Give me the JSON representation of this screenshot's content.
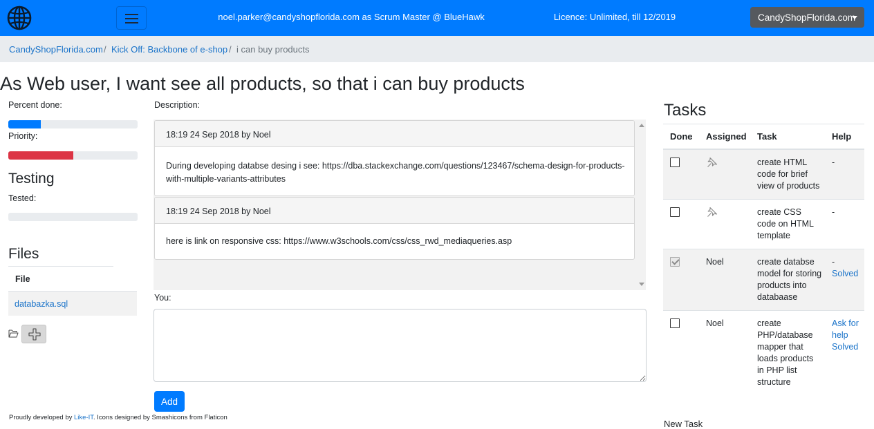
{
  "navbar": {
    "user_info": "noel.parker@candyshopflorida.com as Scrum Master @ BlueHawk",
    "licence": "Licence: Unlimited, till 12/2019",
    "company_dropdown": "CandyShopFlorida.com",
    "brand_color": "#007bff"
  },
  "breadcrumb": {
    "items": [
      "CandyShopFlorida.com",
      "Kick Off: Backbone of e-shop",
      "i can buy products"
    ]
  },
  "page_title": "As Web user, I want see all products, so that i can buy products",
  "progress": {
    "percent_done_label": "Percent done:",
    "percent_done_fraction": 0.25,
    "priority_label": "Priority:",
    "priority_fraction": 0.5,
    "priority_color": "#dc3545"
  },
  "testing": {
    "heading": "Testing",
    "tested_label": "Tested:",
    "tested_fraction": 0
  },
  "files": {
    "heading": "Files",
    "column_header": "File",
    "items": [
      "databazka.sql"
    ]
  },
  "description": {
    "label": "Description:",
    "comments": [
      {
        "header": "18:19 24 Sep 2018 by Noel",
        "body": "During developing databse desing i see: https://dba.stackexchange.com/questions/123467/schema-design-for-products-with-multiple-variants-attributes"
      },
      {
        "header": "18:19 24 Sep 2018 by Noel",
        "body": "here is link on responsive css: https://www.w3schools.com/css/css_rwd_mediaqueries.asp"
      }
    ]
  },
  "new_comment": {
    "label": "You:",
    "value": "",
    "add_button": "Add"
  },
  "footer": {
    "prefix": "Proudly developed by",
    "link": "Like-IT",
    "suffix": ". Icons designed by Smashicons from Flaticon"
  },
  "tasks": {
    "heading": "Tasks",
    "columns": [
      "Done",
      "Assigned",
      "Task",
      "Help"
    ],
    "rows": [
      {
        "done": false,
        "assigned": "",
        "task": "create HTML code for brief view of products",
        "help": "-",
        "help_links": []
      },
      {
        "done": false,
        "assigned": "",
        "task": "create CSS code on HTML template",
        "help": "-",
        "help_links": []
      },
      {
        "done": true,
        "assigned": "Noel",
        "task": "create databse model for storing products into databaase",
        "help": "-",
        "help_links": [
          "Solved"
        ]
      },
      {
        "done": false,
        "assigned": "Noel",
        "task": "create PHP/database mapper that loads products in PHP list structure",
        "help": "",
        "help_links": [
          "Ask for help",
          "Solved"
        ]
      }
    ],
    "more_label": "New Task"
  }
}
